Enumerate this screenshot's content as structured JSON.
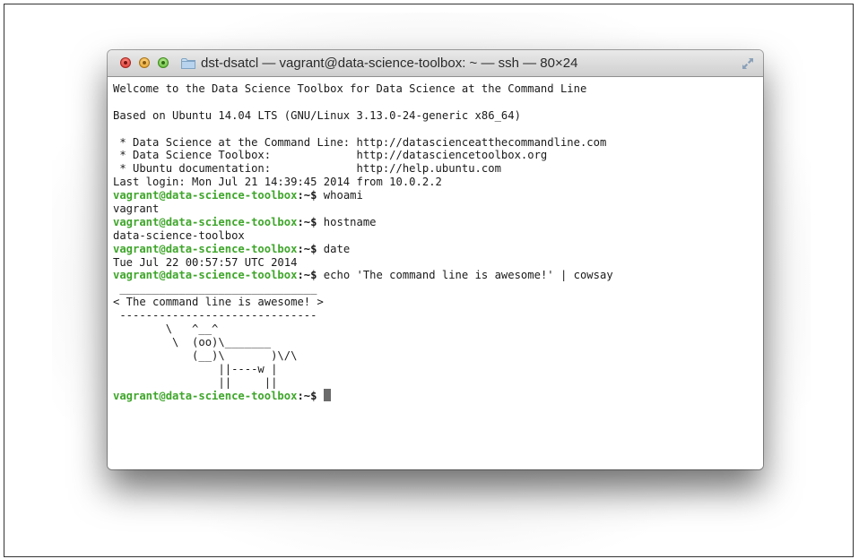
{
  "window": {
    "title": "dst-dsatcl — vagrant@data-science-toolbox: ~ — ssh — 80×24"
  },
  "terminal": {
    "prompt_user_host": "vagrant@data-science-toolbox",
    "prompt_suffix": ":~$",
    "lines": {
      "welcome": "Welcome to the Data Science Toolbox for Data Science at the Command Line",
      "blank1": "",
      "based_on": "Based on Ubuntu 14.04 LTS (GNU/Linux 3.13.0-24-generic x86_64)",
      "blank2": "",
      "link1": " * Data Science at the Command Line: http://datascienceatthecommandline.com",
      "link2": " * Data Science Toolbox:             http://datasciencetoolbox.org",
      "link3": " * Ubuntu documentation:             http://help.ubuntu.com",
      "last_login": "Last login: Mon Jul 21 14:39:45 2014 from 10.0.2.2",
      "cmd1": " whoami",
      "out1": "vagrant",
      "cmd2": " hostname",
      "out2": "data-science-toolbox",
      "cmd3": " date",
      "out3": "Tue Jul 22 00:57:57 UTC 2014",
      "cmd4": " echo 'The command line is awesome!' | cowsay",
      "cow1": " ______________________________",
      "cow2": "< The command line is awesome! >",
      "cow3": " ------------------------------",
      "cow4": "        \\   ^__^",
      "cow5": "         \\  (oo)\\_______",
      "cow6": "            (__)\\       )\\/\\",
      "cow7": "                ||----w |",
      "cow8": "                ||     ||",
      "cmd5": " "
    }
  },
  "colors": {
    "prompt": "#3fa62b",
    "text": "#1a1a1a",
    "cursor": "#6b6b6b"
  },
  "icons": {
    "close": "close-button",
    "minimize": "minimize-button",
    "zoom": "zoom-button",
    "folder": "folder-icon",
    "fullscreen": "fullscreen-icon"
  }
}
